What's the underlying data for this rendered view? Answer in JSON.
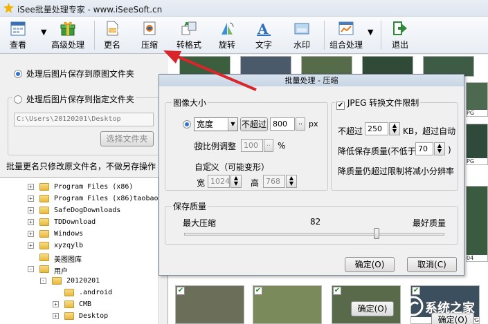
{
  "window": {
    "title": "iSee批量处理专家 - www.iSeeSoft.cn"
  },
  "toolbar": {
    "items": [
      {
        "label": "查看",
        "icon": "calendar-grid-icon"
      },
      {
        "label": "高级处理",
        "icon": "gift-box-icon"
      },
      {
        "label": "更名",
        "icon": "rename-doc-icon"
      },
      {
        "label": "压缩",
        "icon": "compress-icon"
      },
      {
        "label": "转格式",
        "icon": "convert-format-icon"
      },
      {
        "label": "旋转",
        "icon": "rotate-icon"
      },
      {
        "label": "文字",
        "icon": "text-a-icon"
      },
      {
        "label": "水印",
        "icon": "watermark-icon"
      },
      {
        "label": "组合处理",
        "icon": "combo-chart-icon"
      },
      {
        "label": "退出",
        "icon": "exit-arrow-icon"
      }
    ]
  },
  "left_panel": {
    "save_original": "处理后图片保存到原图文件夹",
    "save_specified": "处理后图片保存到指定文件夹",
    "path_value": "C:\\Users\\20120201\\Desktop",
    "choose_folder": "选择文件夹",
    "rename_note": "批量更名只修改原文件名，不做另存操作"
  },
  "tree": {
    "items": [
      {
        "label": "Program Files (x86)"
      },
      {
        "label": "Program Files (x86)taobao"
      },
      {
        "label": "SafeDogDownloads"
      },
      {
        "label": "TDDownload"
      },
      {
        "label": "Windows"
      },
      {
        "label": "xyzqylb"
      },
      {
        "label": "美图图库"
      },
      {
        "label": "用户"
      },
      {
        "label": "20120201"
      },
      {
        "label": ".android"
      },
      {
        "label": "CMB"
      },
      {
        "label": "Desktop"
      }
    ]
  },
  "thumbs": {
    "labels": [
      "PG",
      "PG",
      "04",
      "JPG"
    ]
  },
  "dialog": {
    "title": "批量处理 - 压缩",
    "image_size": "图像大小",
    "width_option": "宽度",
    "not_exceed": "不超过",
    "width_value": "800",
    "px": "px",
    "scale_option": "按比例调整",
    "scale_value": "100",
    "percent": "%",
    "custom_option": "自定义（可能变形）",
    "w_label": "宽",
    "w_value": "1024",
    "h_label": "高",
    "h_value": "768",
    "jpeg_limit": "JPEG 转换文件限制",
    "size_prefix": "不超过",
    "size_value": "250",
    "size_suffix": "KB，超过自动",
    "quality_reduce": "降低保存质量(不低于",
    "quality_min": "70",
    "quality_close": ")",
    "resolution_note": "降质量仍超过限制将减小分辨率",
    "save_quality": "保存质量",
    "max_compress": "最大压缩",
    "quality_value": "82",
    "best_quality": "最好质量",
    "ok": "确定(O)",
    "cancel": "取消(C)"
  },
  "background": {
    "ok1": "确定(O)",
    "ok2": "确定(O)"
  },
  "watermark": "系统之家",
  "colors": {
    "arrow": "#d9262b",
    "accent": "#2a74d6"
  },
  "slider": {
    "value_fraction": 0.82
  }
}
